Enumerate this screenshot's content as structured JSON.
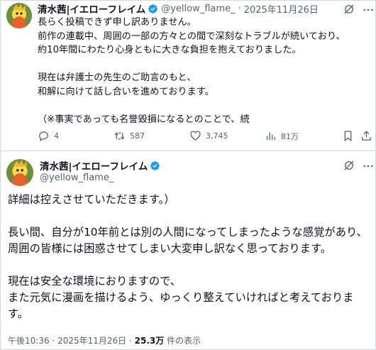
{
  "tweet1": {
    "name": "清水茜|イエローフレイム",
    "handle": "@yellow_flame_",
    "separator": "·",
    "date": "2025年11月26日",
    "text": "長らく投稿できず申し訳ありません。\n前作の連載中、周囲の一部の方々との間で深刻なトラブルが続いており、\n約10年間にわたり心身ともに大きな負担を抱えておりました。\n\n現在は弁護士の先生のご助言のもと、\n和解に向けて話し合いを進めております。\n\n（※事実であっても名誉毀損になるとのことで、続",
    "actions": {
      "replies": "4",
      "reposts": "587",
      "likes": "3,745",
      "views": "81万"
    }
  },
  "tweet2": {
    "name": "清水茜|イエローフレイム",
    "handle": "@yellow_flame_",
    "text": "詳細は控えさせていただきます。）\n\n長い間、自分が10年前とは別の人間になってしまったような感覚があり、\n周囲の皆様には困惑させてしまい大変申し訳なく思っております。\n\n現在は安全な環境におりますので、\nまた元気に漫画を描けるよう、ゆっくり整えていければと考えておりま\nす。",
    "time": "午後10:36",
    "separator": "·",
    "date": "2025年11月26日",
    "views_count": "25.3万",
    "views_label": " 件の表示"
  },
  "colors": {
    "verified": "#1d9bf0",
    "secondary_text": "#536471",
    "primary_text": "#0f1419",
    "divider": "#cfd9de"
  },
  "icons": [
    "verified-badge-icon",
    "grok-icon",
    "more-icon",
    "reply-icon",
    "repost-icon",
    "like-icon",
    "views-icon",
    "bookmark-icon",
    "share-icon"
  ]
}
